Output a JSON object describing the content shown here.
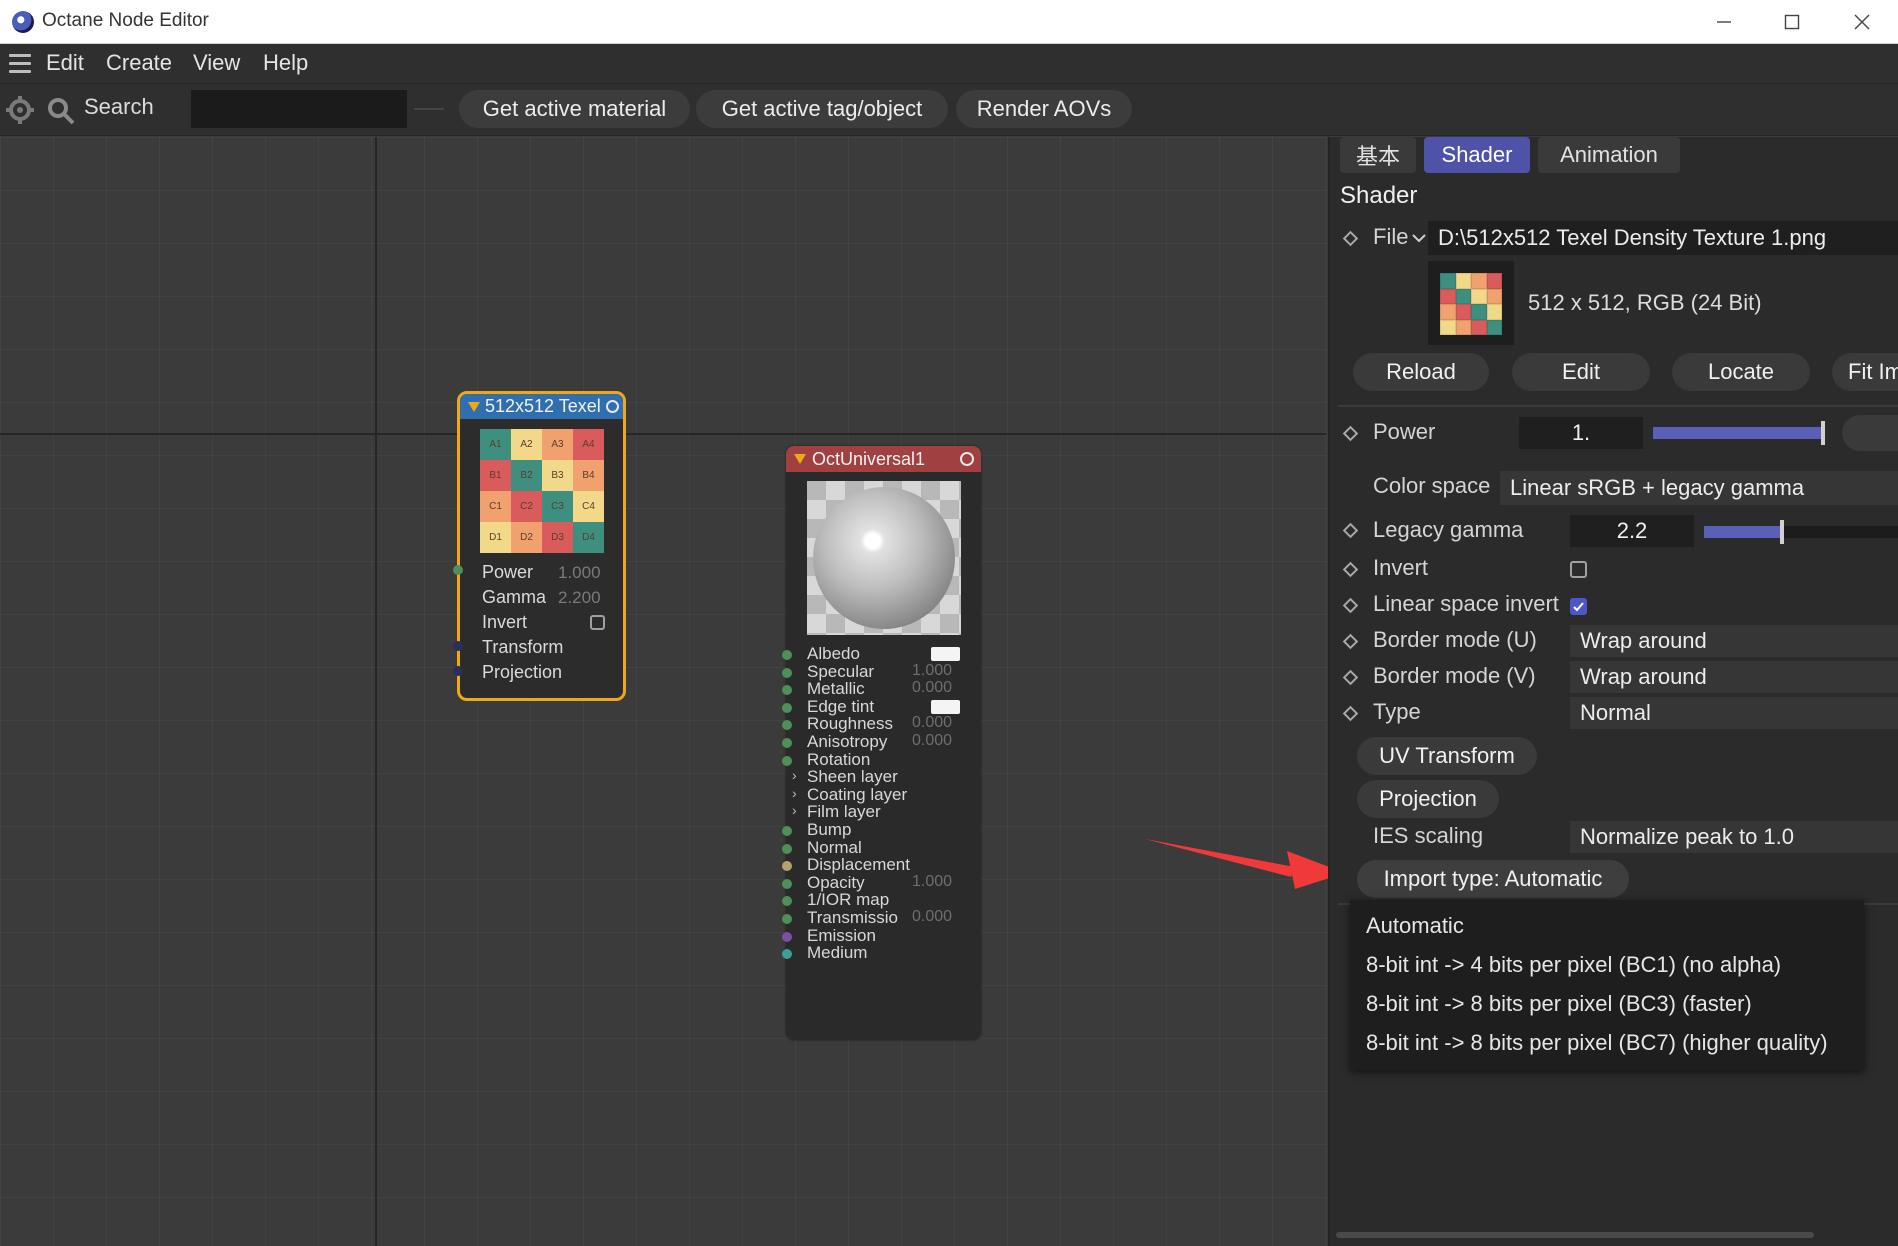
{
  "window": {
    "title": "Octane Node Editor"
  },
  "menu": {
    "items": [
      "Edit",
      "Create",
      "View",
      "Help"
    ]
  },
  "toolbar": {
    "search_label": "Search",
    "search_value": "",
    "buttons": [
      "Get active material",
      "Get active tag/object",
      "Render AOVs"
    ]
  },
  "texture_node": {
    "title": "512x512 Texel",
    "grid": [
      [
        "A1",
        "A2",
        "A3",
        "A4"
      ],
      [
        "B1",
        "B2",
        "B3",
        "B4"
      ],
      [
        "C1",
        "C2",
        "C3",
        "C4"
      ],
      [
        "D1",
        "D2",
        "D3",
        "D4"
      ]
    ],
    "grid_colors": [
      [
        "#3f8f80",
        "#f2d98a",
        "#f0a16e",
        "#d95b5b"
      ],
      [
        "#d95b5b",
        "#3f8f80",
        "#f2d98a",
        "#f0a16e"
      ],
      [
        "#f0a16e",
        "#d95b5b",
        "#3f8f80",
        "#f2d98a"
      ],
      [
        "#f2d98a",
        "#f0a16e",
        "#d95b5b",
        "#3f8f80"
      ]
    ],
    "params": [
      {
        "label": "Power",
        "value": "1.000"
      },
      {
        "label": "Gamma",
        "value": "2.200"
      },
      {
        "label": "Invert",
        "value": ""
      },
      {
        "label": "Transform",
        "value": ""
      },
      {
        "label": "Projection",
        "value": ""
      }
    ]
  },
  "material_node": {
    "title": "OctUniversal1",
    "params": [
      {
        "label": "Albedo",
        "value": "",
        "swatch": true,
        "pin": "#4f8f5a"
      },
      {
        "label": "Specular",
        "value": "1.000",
        "pin": "#4f8f5a"
      },
      {
        "label": "Metallic",
        "value": "0.000",
        "pin": "#4f8f5a"
      },
      {
        "label": "Edge tint",
        "value": "",
        "swatch": true,
        "pin": "#4f8f5a"
      },
      {
        "label": "Roughness",
        "value": "0.000",
        "pin": "#4f8f5a"
      },
      {
        "label": "Anisotropy",
        "value": "0.000",
        "pin": "#4f8f5a"
      },
      {
        "label": "Rotation",
        "value": "",
        "pin": "#4f8f5a"
      },
      {
        "label": "Sheen layer",
        "value": "",
        "group": true
      },
      {
        "label": "Coating layer",
        "value": "",
        "group": true
      },
      {
        "label": "Film layer",
        "value": "",
        "group": true
      },
      {
        "label": "Bump",
        "value": "",
        "pin": "#4f8f5a"
      },
      {
        "label": "Normal",
        "value": "",
        "pin": "#4f8f5a"
      },
      {
        "label": "Displacement",
        "value": "",
        "pin": "#b8a070"
      },
      {
        "label": "Opacity",
        "value": "1.000",
        "pin": "#4f8f5a"
      },
      {
        "label": "1/IOR map",
        "value": "",
        "pin": "#4f8f5a"
      },
      {
        "label": "Transmissio",
        "value": "0.000",
        "pin": "#4f8f5a"
      },
      {
        "label": "Emission",
        "value": "",
        "pin": "#7a4fa8"
      },
      {
        "label": "Medium",
        "value": "",
        "pin": "#3aa09a"
      }
    ]
  },
  "panel": {
    "tabs": [
      {
        "label": "基本",
        "active": false
      },
      {
        "label": "Shader",
        "active": true
      },
      {
        "label": "Animation",
        "active": false
      }
    ],
    "section_title": "Shader",
    "file_label": "File",
    "file_path": "D:\\512x512 Texel Density Texture 1.png",
    "file_info": "512 x 512, RGB (24 Bit)",
    "file_buttons": [
      "Reload",
      "Edit",
      "Locate",
      "Fit Image"
    ],
    "power_label": "Power",
    "power_value": "1.",
    "power_level": 1.0,
    "color_space_label": "Color space",
    "color_space_value": "Linear sRGB + legacy gamma",
    "legacy_gamma_label": "Legacy gamma",
    "legacy_gamma_value": "2.2",
    "legacy_gamma_level": 0.4,
    "invert_label": "Invert",
    "invert_checked": false,
    "linear_invert_label": "Linear space invert",
    "linear_invert_checked": true,
    "border_u_label": "Border mode (U)",
    "border_u_value": "Wrap around",
    "border_v_label": "Border mode (V)",
    "border_v_value": "Wrap around",
    "type_label": "Type",
    "type_value": "Normal",
    "uv_transform_label": "UV Transform",
    "projection_label": "Projection",
    "ies_label": "IES scaling",
    "ies_value": "Normalize peak to 1.0",
    "import_type_label": "Import type: Automatic"
  },
  "dropdown": {
    "options": [
      "Automatic",
      "8-bit int -> 4 bits per pixel (BC1) (no alpha)",
      "8-bit int -> 8 bits per pixel (BC3) (faster)",
      "8-bit int -> 8 bits per pixel (BC7) (higher quality)"
    ]
  },
  "colors": {
    "accent": "#4e52a8",
    "texture_node_border": "#f0a818",
    "texture_node_header": "#2f6fb0",
    "material_node_header": "#a04040",
    "annotation_arrow": "#f03a3a"
  }
}
